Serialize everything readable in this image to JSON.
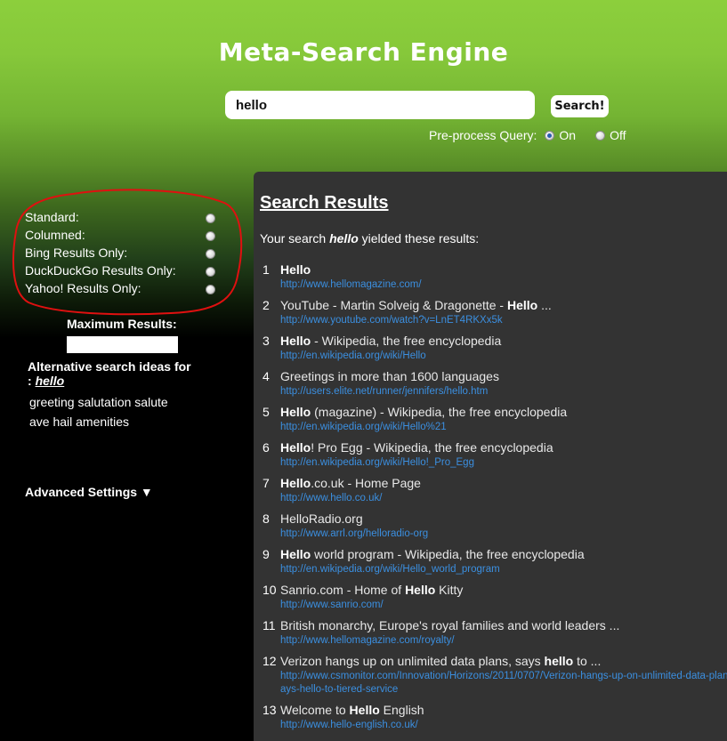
{
  "app": {
    "title": "Meta-Search Engine"
  },
  "search": {
    "query": "hello",
    "button_label": "Search!",
    "preprocess_label": "Pre-process Query:",
    "preprocess_on_label": "On",
    "preprocess_off_label": "Off",
    "preprocess_selected": "On"
  },
  "sidebar": {
    "display_options": [
      {
        "label": "Standard:",
        "selected": false
      },
      {
        "label": "Columned:",
        "selected": false
      },
      {
        "label": "Bing Results Only:",
        "selected": false
      },
      {
        "label": "DuckDuckGo Results Only:",
        "selected": false
      },
      {
        "label": "Yahoo! Results Only:",
        "selected": false
      }
    ],
    "max_results_label": "Maximum Results:",
    "max_results_value": "",
    "alt_title_prefix": "Alternative search ideas for :",
    "alt_title_query": "hello",
    "alt_words": "greeting salutation salute ave hail amenities",
    "advanced_label": "Advanced Settings ▼"
  },
  "results": {
    "heading": "Search Results",
    "summary_prefix": "Your search",
    "summary_query": "hello",
    "summary_suffix": "yielded these results:",
    "items": [
      {
        "num": "1",
        "title_bold": "Hello",
        "title_rest": "",
        "url": "http://www.hellomagazine.com/"
      },
      {
        "num": "2",
        "title_pre": "YouTube - Martin Solveig & Dragonette - ",
        "title_bold": "Hello",
        "title_rest": " ...",
        "url": "http://www.youtube.com/watch?v=LnET4RKXx5k"
      },
      {
        "num": "3",
        "title_bold": "Hello",
        "title_rest": " - Wikipedia, the free encyclopedia",
        "url": "http://en.wikipedia.org/wiki/Hello"
      },
      {
        "num": "4",
        "title_pre": "Greetings in more than 1600 languages",
        "url": "http://users.elite.net/runner/jennifers/hello.htm"
      },
      {
        "num": "5",
        "title_bold": "Hello",
        "title_rest": " (magazine) - Wikipedia, the free encyclopedia",
        "url": "http://en.wikipedia.org/wiki/Hello%21"
      },
      {
        "num": "6",
        "title_bold": "Hello",
        "title_rest": "! Pro Egg - Wikipedia, the free encyclopedia",
        "url": "http://en.wikipedia.org/wiki/Hello!_Pro_Egg"
      },
      {
        "num": "7",
        "title_bold": "Hello",
        "title_rest": ".co.uk - Home Page",
        "url": "http://www.hello.co.uk/"
      },
      {
        "num": "8",
        "title_pre": "HelloRadio.org",
        "url": "http://www.arrl.org/helloradio-org"
      },
      {
        "num": "9",
        "title_bold": "Hello",
        "title_rest": " world program - Wikipedia, the free encyclopedia",
        "url": "http://en.wikipedia.org/wiki/Hello_world_program"
      },
      {
        "num": "10",
        "title_pre": "Sanrio.com - Home of ",
        "title_bold": "Hello",
        "title_rest": " Kitty",
        "url": "http://www.sanrio.com/"
      },
      {
        "num": "11",
        "title_pre": "British monarchy, Europe's royal families and world leaders ...",
        "url": "http://www.hellomagazine.com/royalty/"
      },
      {
        "num": "12",
        "title_pre": "Verizon hangs up on unlimited data plans, says ",
        "title_bold": "hello",
        "title_rest": " to ...",
        "url": "http://www.csmonitor.com/Innovation/Horizons/2011/0707/Verizon-hangs-up-on-unlimited-data-plans-says-hello-to-tiered-service"
      },
      {
        "num": "13",
        "title_pre": "Welcome to ",
        "title_bold": "Hello",
        "title_rest": " English",
        "url": "http://www.hello-english.co.uk/"
      }
    ]
  }
}
